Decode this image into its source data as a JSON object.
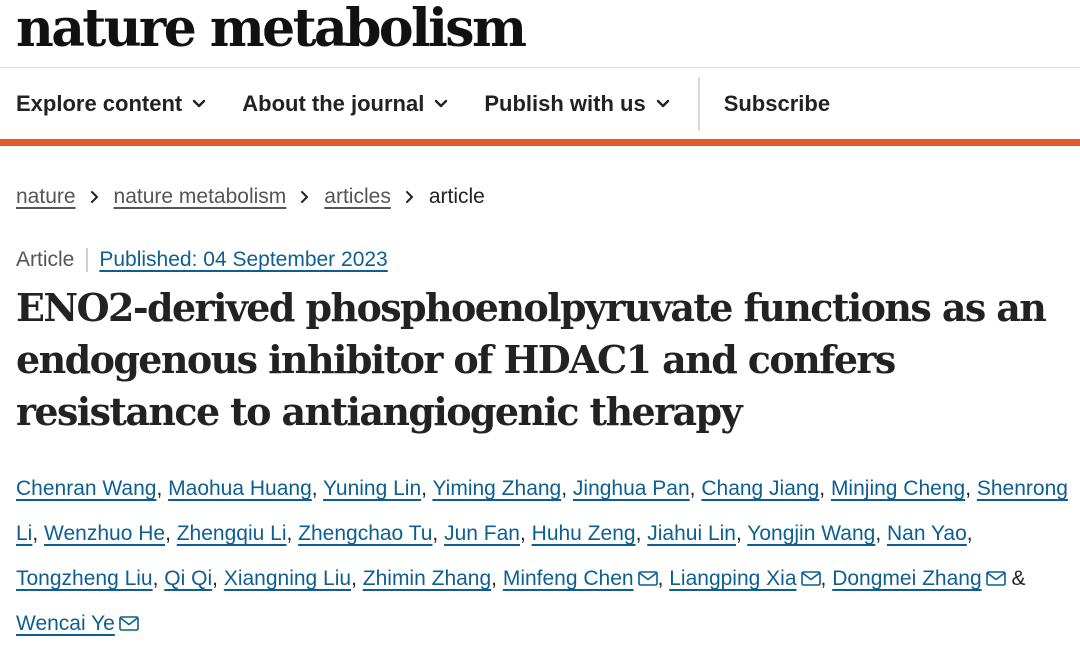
{
  "masthead": {
    "logo_text": "nature metabolism"
  },
  "nav": {
    "items": [
      {
        "label": "Explore content",
        "icon": "chevron-down-icon"
      },
      {
        "label": "About the journal",
        "icon": "chevron-down-icon"
      },
      {
        "label": "Publish with us",
        "icon": "chevron-down-icon"
      }
    ],
    "subscribe_label": "Subscribe",
    "accent_color": "#e05a2b"
  },
  "breadcrumbs": {
    "items": [
      {
        "label": "nature"
      },
      {
        "label": "nature metabolism"
      },
      {
        "label": "articles"
      },
      {
        "label": "article"
      }
    ],
    "separator_icon": "chevron-right-icon"
  },
  "article": {
    "type": "Article",
    "published": "Published: 04 September 2023",
    "title": "ENO2-derived phosphoenolpyruvate functions as an endogenous inhibitor of HDAC1 and confers resistance to antiangiogenic therapy",
    "authors": [
      {
        "name": "Chenran Wang"
      },
      {
        "name": "Maohua Huang"
      },
      {
        "name": "Yuning Lin"
      },
      {
        "name": "Yiming Zhang"
      },
      {
        "name": "Jinghua Pan"
      },
      {
        "name": "Chang Jiang"
      },
      {
        "name": "Minjing Cheng"
      },
      {
        "name": "Shenrong Li"
      },
      {
        "name": "Wenzhuo He"
      },
      {
        "name": "Zhengqiu Li"
      },
      {
        "name": "Zhengchao Tu"
      },
      {
        "name": "Jun Fan"
      },
      {
        "name": "Huhu Zeng"
      },
      {
        "name": "Jiahui Lin"
      },
      {
        "name": "Yongjin Wang"
      },
      {
        "name": "Nan Yao"
      },
      {
        "name": "Tongzheng Liu"
      },
      {
        "name": "Qi Qi"
      },
      {
        "name": "Xiangning Liu"
      },
      {
        "name": "Zhimin Zhang"
      },
      {
        "name": "Minfeng Chen",
        "corresponding": true
      },
      {
        "name": "Liangping Xia",
        "corresponding": true
      },
      {
        "name": "Dongmei Zhang",
        "corresponding": true
      },
      {
        "name": "Wencai Ye",
        "corresponding": true
      }
    ],
    "link_color": "#0d5e92",
    "mail_icon": "mail-icon"
  },
  "text": {
    "comma": ", ",
    "ampersand": " & "
  }
}
